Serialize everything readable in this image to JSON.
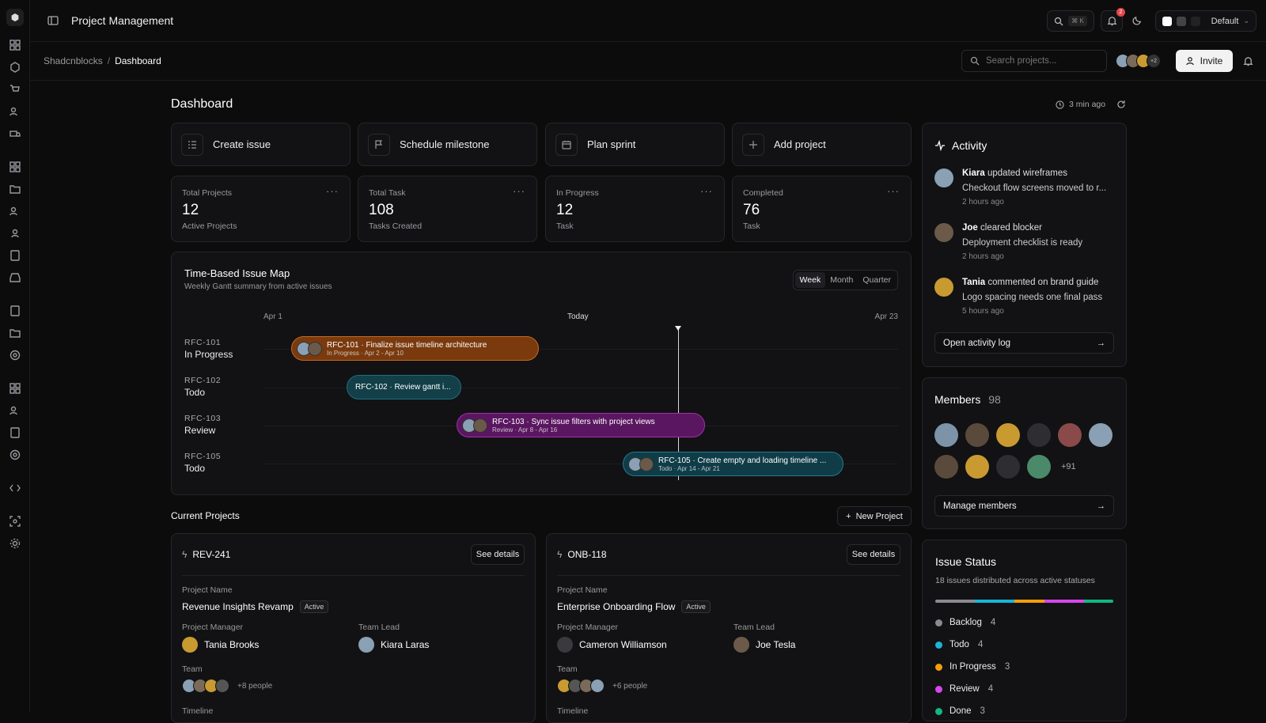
{
  "app": {
    "title": "Project Management",
    "theme_label": "Default",
    "search_shortcut": "⌘ K",
    "notif_count": "2"
  },
  "breadcrumb": {
    "root": "Shadcnblocks",
    "current": "Dashboard"
  },
  "search": {
    "placeholder": "Search projects..."
  },
  "invite": {
    "label": "Invite",
    "extra_avatars": "+2"
  },
  "page": {
    "title": "Dashboard",
    "updated": "3 min ago"
  },
  "quick_actions": [
    {
      "label": "Create issue",
      "icon": "list-icon"
    },
    {
      "label": "Schedule milestone",
      "icon": "flag-icon"
    },
    {
      "label": "Plan sprint",
      "icon": "calendar-icon"
    },
    {
      "label": "Add project",
      "icon": "plus-icon"
    }
  ],
  "stats": [
    {
      "label": "Total Projects",
      "value": "12",
      "sub": "Active Projects"
    },
    {
      "label": "Total Task",
      "value": "108",
      "sub": "Tasks Created"
    },
    {
      "label": "In Progress",
      "value": "12",
      "sub": "Task"
    },
    {
      "label": "Completed",
      "value": "76",
      "sub": "Task"
    }
  ],
  "gantt": {
    "title": "Time-Based Issue Map",
    "subtitle": "Weekly Gantt summary from active issues",
    "ranges": [
      "Week",
      "Month",
      "Quarter"
    ],
    "active_range": "Week",
    "axis": {
      "start": "Apr 1",
      "today": "Today",
      "end": "Apr 23"
    },
    "rows": [
      {
        "id": "RFC-101",
        "status": "In Progress",
        "title": "RFC-101 · Finalize issue timeline architecture",
        "meta": "In Progress · Apr 2 - Apr 10",
        "color": "#7a3a0e",
        "border": "#c26a1e"
      },
      {
        "id": "RFC-102",
        "status": "Todo",
        "title": "RFC-102 · Review gantt i...",
        "meta": "",
        "color": "#123f48",
        "border": "#1f6f80"
      },
      {
        "id": "RFC-103",
        "status": "Review",
        "title": "RFC-103 · Sync issue filters with project views",
        "meta": "Review · Apr 8 - Apr 16",
        "color": "#5a1660",
        "border": "#a030a8"
      },
      {
        "id": "RFC-105",
        "status": "Todo",
        "title": "RFC-105 · Create empty and loading timeline ...",
        "meta": "Todo · Apr 14 - Apr 21",
        "color": "#0f3c47",
        "border": "#1e7d90"
      }
    ]
  },
  "current_projects": {
    "title": "Current Projects",
    "new_label": "New Project",
    "items": [
      {
        "code": "REV-241",
        "details": "See details",
        "name_label": "Project Name",
        "name": "Revenue Insights Revamp",
        "status": "Active",
        "pm_label": "Project Manager",
        "pm": "Tania Brooks",
        "lead_label": "Team Lead",
        "lead": "Kiara Laras",
        "team_label": "Team",
        "team_extra": "+8 people",
        "timeline_label": "Timeline"
      },
      {
        "code": "ONB-118",
        "details": "See details",
        "name_label": "Project Name",
        "name": "Enterprise Onboarding Flow",
        "status": "Active",
        "pm_label": "Project Manager",
        "pm": "Cameron Williamson",
        "lead_label": "Team Lead",
        "lead": "Joe Tesla",
        "team_label": "Team",
        "team_extra": "+6 people",
        "timeline_label": "Timeline"
      }
    ]
  },
  "activity": {
    "title": "Activity",
    "items": [
      {
        "user": "Kiara",
        "action": "updated wireframes",
        "detail": "Checkout flow screens moved to r...",
        "time": "2 hours ago"
      },
      {
        "user": "Joe",
        "action": "cleared blocker",
        "detail": "Deployment checklist is ready",
        "time": "2 hours ago"
      },
      {
        "user": "Tania",
        "action": "commented on brand guide",
        "detail": "Logo spacing needs one final pass",
        "time": "5 hours ago"
      }
    ],
    "open_log": "Open activity log"
  },
  "members": {
    "title": "Members",
    "count": "98",
    "extra": "+91",
    "manage": "Manage members"
  },
  "issue_status": {
    "title": "Issue Status",
    "subtitle": "18 issues distributed across active statuses",
    "items": [
      {
        "label": "Backlog",
        "count": "4",
        "color": "#8a8a90"
      },
      {
        "label": "Todo",
        "count": "4",
        "color": "#18b6d8"
      },
      {
        "label": "In Progress",
        "count": "3",
        "color": "#f59e0b"
      },
      {
        "label": "Review",
        "count": "4",
        "color": "#d946ef"
      },
      {
        "label": "Done",
        "count": "3",
        "color": "#10b981"
      }
    ]
  }
}
